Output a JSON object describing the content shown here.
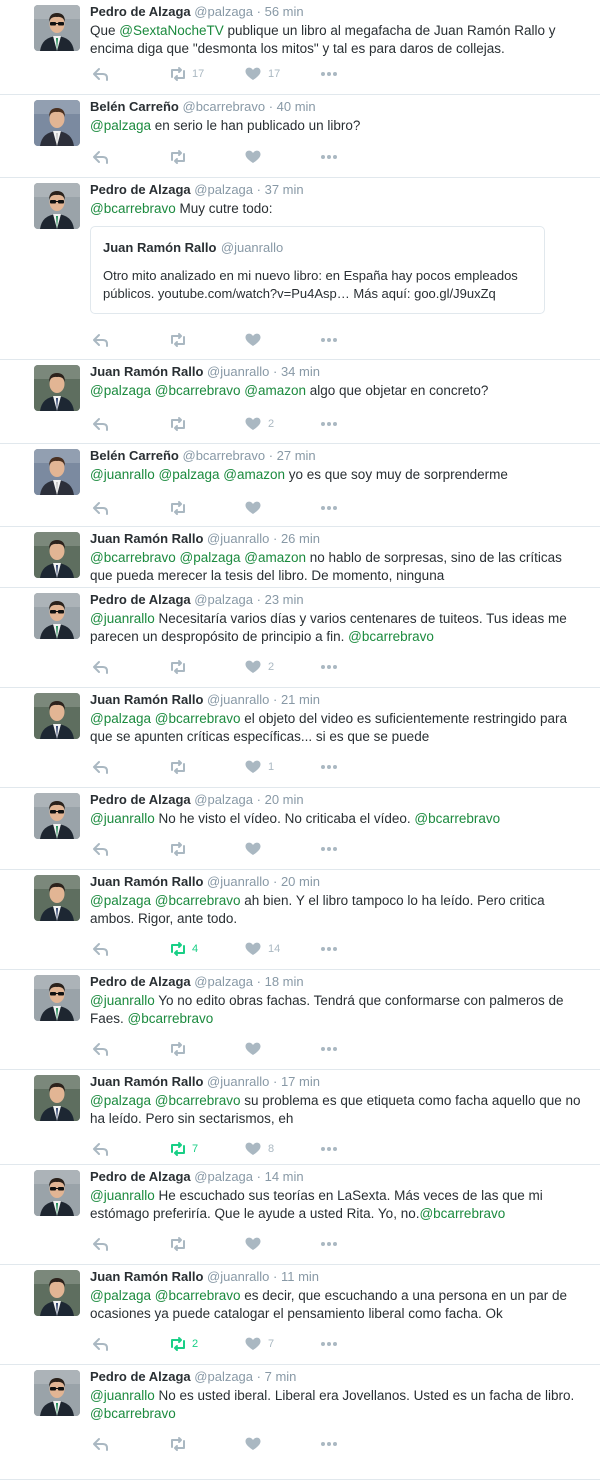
{
  "colors": {
    "link": "#2b7bb9",
    "link_green": "#1b8a3e",
    "muted": "#8899a6",
    "retweet_active": "#19cf86"
  },
  "icons": {
    "reply": "reply-icon",
    "retweet": "retweet-icon",
    "like": "heart-icon",
    "more": "more-icon"
  },
  "tweets": [
    {
      "name": "Pedro de Alzaga",
      "handle": "@palzaga",
      "time": "· 56 min",
      "parts": [
        [
          "t",
          "Que "
        ],
        [
          "m",
          "@SextaNocheTV"
        ],
        [
          "t",
          " publique un libro al megafacha de Juan Ramón Rallo y encima diga que \"desmonta los mitos\" y tal es para daros de collejas."
        ]
      ],
      "retweets": "17",
      "likes": "17"
    },
    {
      "name": "Belén Carreño",
      "handle": "@bcarrebravo",
      "time": "· 40 min",
      "parts": [
        [
          "m",
          "@palzaga"
        ],
        [
          "t",
          " en serio le han publicado un libro?"
        ]
      ],
      "retweets": "",
      "likes": ""
    },
    {
      "name": "Pedro de Alzaga",
      "handle": "@palzaga",
      "time": "· 37 min",
      "parts": [
        [
          "m",
          "@bcarrebravo"
        ],
        [
          "t",
          " Muy cutre todo:"
        ]
      ],
      "quote": {
        "name": "Juan Ramón Rallo",
        "handle": "@juanrallo",
        "text": "Otro mito analizado en mi nuevo libro: en España hay pocos empleados públicos. youtube.com/watch?v=Pu4Asp… Más aquí: goo.gl/J9uxZq"
      },
      "retweets": "",
      "likes": ""
    },
    {
      "name": "Juan Ramón Rallo",
      "handle": "@juanrallo",
      "time": "· 34 min",
      "parts": [
        [
          "m",
          "@palzaga"
        ],
        [
          "t",
          " "
        ],
        [
          "m",
          "@bcarrebravo"
        ],
        [
          "t",
          " "
        ],
        [
          "m",
          "@amazon"
        ],
        [
          "t",
          " algo que objetar en concreto?"
        ]
      ],
      "retweets": "",
      "likes": "2"
    },
    {
      "name": "Belén Carreño",
      "handle": "@bcarrebravo",
      "time": "· 27 min",
      "parts": [
        [
          "m",
          "@juanrallo"
        ],
        [
          "t",
          " "
        ],
        [
          "m",
          "@palzaga"
        ],
        [
          "t",
          " "
        ],
        [
          "m",
          "@amazon"
        ],
        [
          "t",
          " yo es que soy muy de sorprenderme"
        ]
      ],
      "retweets": "",
      "likes": ""
    },
    {
      "name": "Juan Ramón Rallo",
      "handle": "@juanrallo",
      "time": "· 26 min",
      "parts": [
        [
          "m",
          "@bcarrebravo"
        ],
        [
          "t",
          " "
        ],
        [
          "m",
          "@palzaga"
        ],
        [
          "t",
          " "
        ],
        [
          "m",
          "@amazon"
        ],
        [
          "t",
          " no hablo de sorpresas, sino de las críticas que pueda merecer la tesis del libro. De momento, ninguna"
        ]
      ],
      "retweets": "",
      "likes": "",
      "no_actions": true
    },
    {
      "name": "Pedro de Alzaga",
      "handle": "@palzaga",
      "time": "· 23 min",
      "parts": [
        [
          "m",
          "@juanrallo"
        ],
        [
          "t",
          " Necesitaría varios días y varios centenares de tuiteos. Tus ideas me parecen un despropósito de principio a fin.  "
        ],
        [
          "m",
          "@bcarrebravo"
        ]
      ],
      "retweets": "",
      "likes": "2"
    },
    {
      "name": "Juan Ramón Rallo",
      "handle": "@juanrallo",
      "time": "· 21 min",
      "parts": [
        [
          "m",
          "@palzaga"
        ],
        [
          "t",
          " "
        ],
        [
          "m",
          "@bcarrebravo"
        ],
        [
          "t",
          " el objeto del video es suficientemente restringido para que se apunten críticas específicas... si es que se puede"
        ]
      ],
      "retweets": "",
      "likes": "1"
    },
    {
      "name": "Pedro de Alzaga",
      "handle": "@palzaga",
      "time": "· 20 min",
      "parts": [
        [
          "m",
          "@juanrallo"
        ],
        [
          "t",
          " No he visto el vídeo. No criticaba el vídeo. "
        ],
        [
          "m",
          "@bcarrebravo"
        ]
      ],
      "retweets": "",
      "likes": ""
    },
    {
      "name": "Juan Ramón Rallo",
      "handle": "@juanrallo",
      "time": "· 20 min",
      "parts": [
        [
          "m",
          "@palzaga"
        ],
        [
          "t",
          " "
        ],
        [
          "m",
          "@bcarrebravo"
        ],
        [
          "t",
          " ah bien. Y el libro tampoco lo ha leído. Pero critica ambos. Rigor, ante todo."
        ]
      ],
      "retweets": "4",
      "likes": "14",
      "rt_active": true
    },
    {
      "name": "Pedro de Alzaga",
      "handle": "@palzaga",
      "time": "· 18 min",
      "parts": [
        [
          "m",
          "@juanrallo"
        ],
        [
          "t",
          " Yo no edito obras fachas. Tendrá que conformarse con palmeros de Faes. "
        ],
        [
          "m",
          "@bcarrebravo"
        ]
      ],
      "retweets": "",
      "likes": ""
    },
    {
      "name": "Juan Ramón Rallo",
      "handle": "@juanrallo",
      "time": "· 17 min",
      "parts": [
        [
          "m",
          "@palzaga"
        ],
        [
          "t",
          " "
        ],
        [
          "m",
          "@bcarrebravo"
        ],
        [
          "t",
          " su problema es que etiqueta como facha aquello que no ha leído. Pero sin sectarismos, eh"
        ]
      ],
      "retweets": "7",
      "likes": "8",
      "rt_active": true
    },
    {
      "name": "Pedro de Alzaga",
      "handle": "@palzaga",
      "time": "· 14 min",
      "parts": [
        [
          "m",
          "@juanrallo"
        ],
        [
          "t",
          " He escuchado sus teorías en LaSexta. Más veces de las que mi estómago preferiría. Que le ayude a usted Rita. Yo, no."
        ],
        [
          "m",
          "@bcarrebravo"
        ]
      ],
      "retweets": "",
      "likes": ""
    },
    {
      "name": "Juan Ramón Rallo",
      "handle": "@juanrallo",
      "time": "· 11 min",
      "parts": [
        [
          "m",
          "@palzaga"
        ],
        [
          "t",
          " "
        ],
        [
          "m",
          "@bcarrebravo"
        ],
        [
          "t",
          " es decir, que escuchando a una persona en un par de ocasiones ya puede catalogar el pensamiento liberal como facha. Ok"
        ]
      ],
      "retweets": "2",
      "likes": "7",
      "rt_active": true
    },
    {
      "name": "Pedro de Alzaga",
      "handle": "@palzaga",
      "time": "· 7 min",
      "parts": [
        [
          "m",
          "@juanrallo"
        ],
        [
          "t",
          " No es usted iberal. Liberal era Jovellanos. Usted es un facha de libro. "
        ],
        [
          "m",
          "@bcarrebravo"
        ]
      ],
      "retweets": "",
      "likes": ""
    }
  ]
}
